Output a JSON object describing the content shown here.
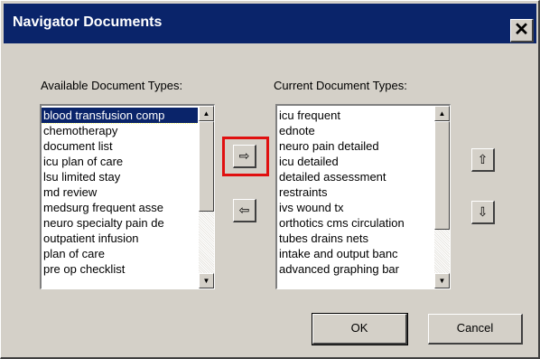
{
  "window": {
    "title": "Navigator Documents",
    "close_label": "✕"
  },
  "available": {
    "label": "Available Document Types:",
    "items": [
      "blood transfusion comp",
      "chemotherapy",
      "document list",
      "icu plan of care",
      "lsu limited stay",
      "md review",
      "medsurg frequent asse",
      "neuro specialty pain de",
      "outpatient infusion",
      "plan of care",
      "pre op checklist"
    ],
    "selected_index": 0
  },
  "current": {
    "label": "Current Document Types:",
    "items": [
      "icu frequent",
      "ednote",
      "neuro pain detailed",
      "icu detailed",
      "detailed assessment",
      "restraints",
      "ivs wound tx",
      "orthotics cms circulation",
      "tubes drains nets",
      "intake and output banc",
      "advanced graphing bar"
    ]
  },
  "buttons": {
    "add_icon": "⇨",
    "remove_icon": "⇦",
    "move_up_icon": "⇧",
    "move_down_icon": "⇩",
    "scroll_up_icon": "▲",
    "scroll_down_icon": "▼",
    "ok_label": "OK",
    "cancel_label": "Cancel"
  },
  "colors": {
    "titlebar": "#0a246a",
    "highlight": "#e01010",
    "face": "#d4d0c8"
  }
}
